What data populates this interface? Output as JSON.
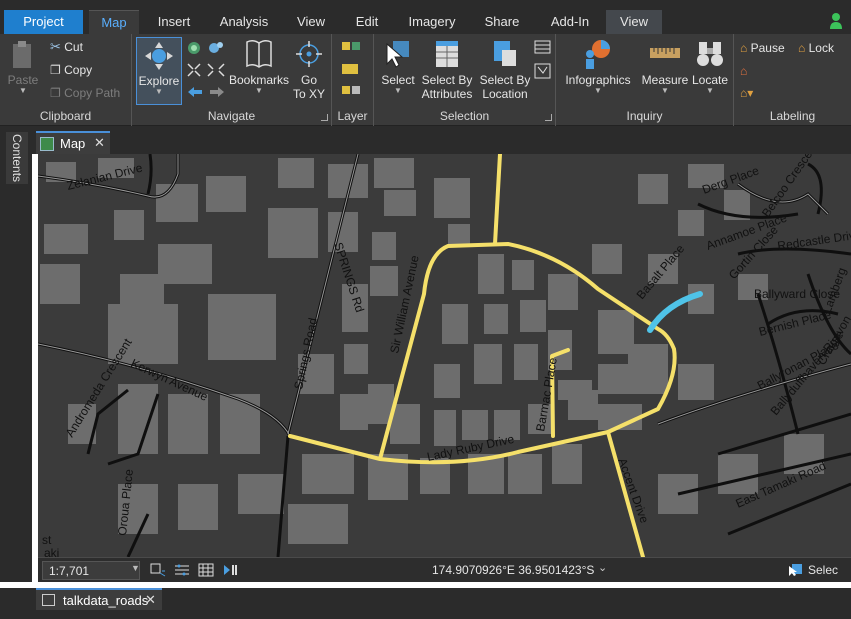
{
  "tabs": [
    {
      "label": "Project"
    },
    {
      "label": "Map"
    },
    {
      "label": "Insert"
    },
    {
      "label": "Analysis"
    },
    {
      "label": "View"
    },
    {
      "label": "Edit"
    },
    {
      "label": "Imagery"
    },
    {
      "label": "Share"
    },
    {
      "label": "Add-In"
    },
    {
      "label": "View"
    }
  ],
  "ribbon": {
    "clipboard": {
      "label": "Clipboard",
      "paste": "Paste",
      "cut": "Cut",
      "copy": "Copy",
      "copy_path": "Copy Path"
    },
    "navigate": {
      "label": "Navigate",
      "explore": "Explore",
      "bookmarks": "Bookmarks",
      "go_to_xy_1": "Go",
      "go_to_xy_2": "To XY"
    },
    "layer": {
      "label": "Layer"
    },
    "selection": {
      "label": "Selection",
      "select": "Select",
      "select_by_attr_1": "Select By",
      "select_by_attr_2": "Attributes",
      "select_by_loc_1": "Select By",
      "select_by_loc_2": "Location"
    },
    "inquiry": {
      "label": "Inquiry",
      "infographics": "Infographics",
      "measure": "Measure",
      "locate": "Locate"
    },
    "labeling": {
      "label": "Labeling",
      "pause": "Pause",
      "lock": "Lock"
    }
  },
  "sidebar": {
    "contents_label": "Contents"
  },
  "map_view": {
    "tab_label": "Map",
    "close_glyph": "✕"
  },
  "map": {
    "streets": [
      "Zelanian Drive",
      "SPRINGS Rd",
      "Sir William Avenue",
      "Kerwyn Avenue",
      "Springs Road",
      "Andromeda Crescent",
      "Lady Ruby Drive",
      "Barmac Place",
      "Basalt Place",
      "Accent Drive",
      "Derg Place",
      "Belcoo Crescent",
      "Annamoe Place",
      "Gortin Close",
      "Redcastle Drive",
      "Ballyward Close",
      "Lamberg",
      "Bernish Place",
      "Craigavon",
      "Ballyronan Place",
      "Ballyduffhaven Rise",
      "East Tamaki Road",
      "Oroua Place",
      "st",
      "aki"
    ],
    "highlight_color": "#f5e06a",
    "selected_color": "#4fc3e8"
  },
  "status": {
    "scale": "1:7,701",
    "coordinates": "174.9070926°E 36.9501423°S",
    "selection_label": "Selec"
  },
  "bottom": {
    "table_tab": "talkdata_roads",
    "close_glyph": "✕"
  }
}
